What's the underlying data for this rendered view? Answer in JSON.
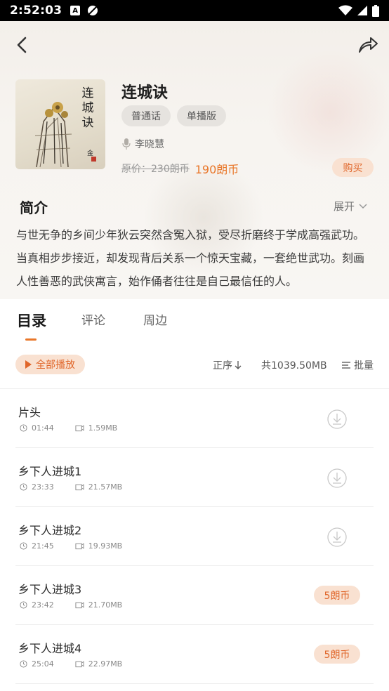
{
  "status_bar": {
    "time": "2:52:03",
    "icons": [
      "a-notification-icon",
      "no-disturb-icon",
      "wifi-icon",
      "signal-icon",
      "battery-icon"
    ]
  },
  "header": {
    "back_icon": "chevron-left-icon",
    "share_icon": "share-icon"
  },
  "book": {
    "cover_title": "连城诀",
    "title": "连城诀",
    "tags": [
      "普通话",
      "单播版"
    ],
    "author": "李晓慧",
    "price_original": "原价：230朗币",
    "price_current": "190朗币",
    "buy_label": "购买"
  },
  "intro": {
    "heading": "简介",
    "expand_label": "展开",
    "text": "与世无争的乡间少年狄云突然含冤入狱，受尽折磨终于学成高强武功。当真相步步接近，却发现背后关系一个惊天宝藏，一套绝世武功。刻画人性善恶的武侠寓言，始作俑者往往是自己最信任的人。"
  },
  "tabs": [
    "目录",
    "评论",
    "周边"
  ],
  "toolbar": {
    "play_all": "全部播放",
    "sort": "正序",
    "total_size": "共1039.50MB",
    "batch": "批量"
  },
  "episodes": [
    {
      "title": "片头",
      "duration": "01:44",
      "size": "1.59MB",
      "action": "download"
    },
    {
      "title": "乡下人进城1",
      "duration": "23:33",
      "size": "21.57MB",
      "action": "download"
    },
    {
      "title": "乡下人进城2",
      "duration": "21:45",
      "size": "19.93MB",
      "action": "download"
    },
    {
      "title": "乡下人进城3",
      "duration": "23:42",
      "size": "21.70MB",
      "action": "price",
      "price": "5朗币"
    },
    {
      "title": "乡下人进城4",
      "duration": "25:04",
      "size": "22.97MB",
      "action": "price",
      "price": "5朗币"
    }
  ],
  "colors": {
    "accent": "#e9772a",
    "accent_bg": "#f9e1d1",
    "tag_bg": "#e6e3df"
  }
}
